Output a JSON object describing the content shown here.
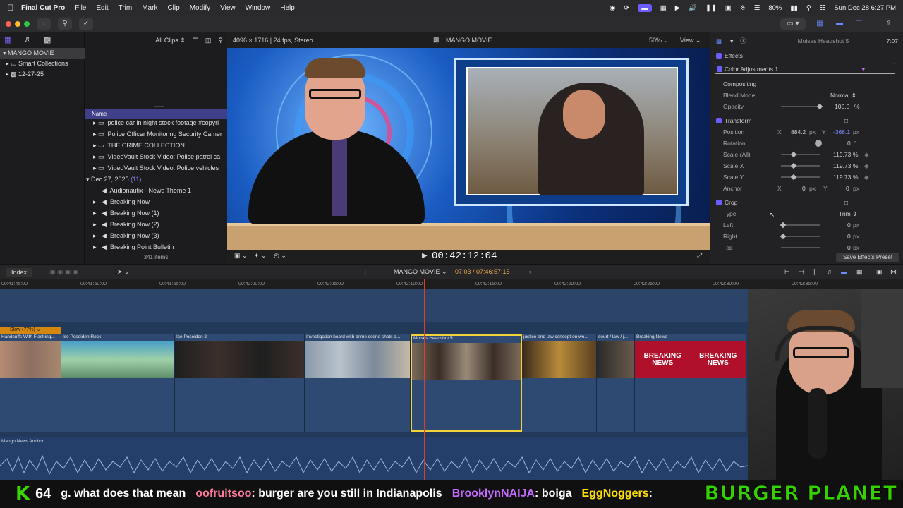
{
  "menubar": {
    "app": "Final Cut Pro",
    "items": [
      "File",
      "Edit",
      "Trim",
      "Mark",
      "Clip",
      "Modify",
      "View",
      "Window",
      "Help"
    ],
    "battery": "80%",
    "datetime": "Sun Dec 28  6:27 PM"
  },
  "library": {
    "items": [
      "MANGO MOVIE",
      "Smart Collections",
      "12-27-25"
    ]
  },
  "browser": {
    "filter": "All Clips",
    "column_header": "Name",
    "rows": [
      "police  car in night stock footage #copyri",
      "Police Officer Monitoring Security Camer",
      "THE CRIME COLLECTION",
      "VideoVault Stock Video:   Police patrol ca",
      "VideoVault Stock Video:   Police vehicles"
    ],
    "date_group": "Dec 27, 2025",
    "date_count": "(11)",
    "audio_rows": [
      "Audionautix - News Theme 1",
      "Breaking Now",
      "Breaking Now (1)",
      "Breaking Now (2)",
      "Breaking Now (3)",
      "Breaking Point Bulletin"
    ],
    "item_count": "341 items"
  },
  "viewer": {
    "format": "4096 × 1716 | 24 fps, Stereo",
    "project": "MANGO MOVIE",
    "zoom": "50%",
    "view_label": "View",
    "timecode": "00:42:12:04"
  },
  "inspector": {
    "clip_name": "Moises Headshot 5",
    "duration": "7:07",
    "effects_label": "Effects",
    "color_adjust": "Color Adjustments 1",
    "compositing": "Compositing",
    "blend_mode_label": "Blend Mode",
    "blend_mode_value": "Normal",
    "opacity_label": "Opacity",
    "opacity_value": "100.0",
    "opacity_unit": "%",
    "transform": "Transform",
    "position_label": "Position",
    "position_x": "884.2",
    "position_y": "-368.1",
    "rotation_label": "Rotation",
    "rotation_value": "0",
    "scale_all_label": "Scale (All)",
    "scale_x_label": "Scale X",
    "scale_y_label": "Scale Y",
    "scale_value": "119.73",
    "anchor_label": "Anchor",
    "anchor_x": "0",
    "anchor_y": "0",
    "crop": "Crop",
    "type_label": "Type",
    "type_value": "Trim",
    "left_label": "Left",
    "right_label": "Right",
    "top_label": "Top",
    "crop_value": "0",
    "px": "px",
    "save_preset": "Save Effects Preset"
  },
  "timeline": {
    "index_label": "Index",
    "project": "MANGO MOVIE",
    "timecode": "07:03 / 07:46:57:15",
    "ruler": [
      "00:41:45:00",
      "00:41:50:00",
      "00:41:55:00",
      "00:42:00:00",
      "00:42:05:00",
      "00:42:10:00",
      "00:42:15:00",
      "00:42:20:00",
      "00:42:25:00",
      "00:42:30:00",
      "00:42:35:00"
    ],
    "retime_label": "Slow (77%)",
    "clips": [
      "Handcuffs With Flashing...",
      "Ice Poseidon Rock",
      "Ice Poseidon 2",
      "Investigation board with crime scene shots a...",
      "Moises Headshot 5",
      "justice and law concept on wo...",
      "court / law / j...",
      "Breaking News"
    ],
    "audio_label": "Mango News Anchor",
    "breaking_text": "BREAKING NEWS"
  },
  "ticker": {
    "k_logo": "K",
    "count": "64",
    "msg1": "g. what does that mean",
    "user1": "oofruitsoo",
    "msg2": ": burger are you still in Indianapolis",
    "user2": "BrooklynNAIJA",
    "msg3": ": boiga",
    "user3": "EggNoggers",
    "msg4": ":",
    "brand": "BURGER PLANET"
  },
  "colors": {
    "accent": "#6a5cff",
    "playhead": "#e23b2b",
    "selection": "#f2d43a",
    "timeline_bg": "#23395a"
  }
}
